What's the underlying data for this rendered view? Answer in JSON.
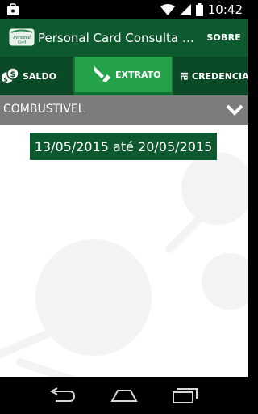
{
  "status_bar": {
    "time": "10:42",
    "icons": [
      "notification-bag-icon",
      "wifi-icon",
      "signal-icon",
      "battery-icon"
    ]
  },
  "action_bar": {
    "logo_text": "Personal Card",
    "title": "Personal Card Consulta de Saldo",
    "sobre_label": "SOBRE"
  },
  "tabs": [
    {
      "label": "SALDO",
      "icon": "coins-icon",
      "selected": false
    },
    {
      "label": "EXTRATO",
      "icon": "extrato-arrows-icon",
      "selected": true
    },
    {
      "label": "CREDENCIADOS",
      "icon": "store-icon",
      "selected": false
    }
  ],
  "content": {
    "category": "COMBUSTIVEL",
    "date_range": "13/05/2015 até 20/05/2015"
  },
  "nav_bar": {
    "icons": [
      "back-icon",
      "home-icon",
      "recent-apps-icon"
    ]
  },
  "colors": {
    "action_bar": "#0d5a2f",
    "tab_selected": "#24a34a",
    "category_bar": "#7c7c7c",
    "date_box": "#0c5a2e"
  }
}
